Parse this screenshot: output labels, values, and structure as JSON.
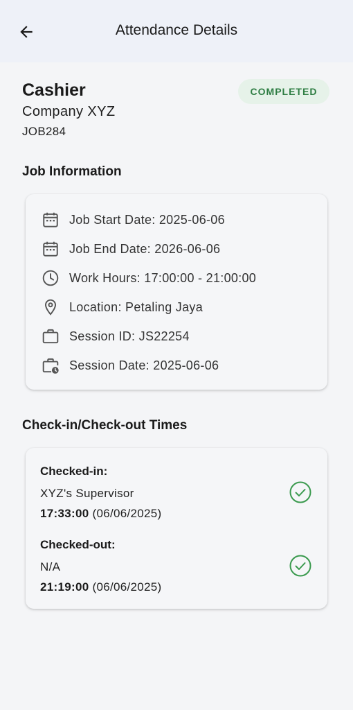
{
  "header": {
    "title": "Attendance Details",
    "back_icon": "arrow-left-icon"
  },
  "job": {
    "title": "Cashier",
    "company": "Company XYZ",
    "code": "JOB284",
    "status": "COMPLETED",
    "status_color": "#2e7d43",
    "status_bg": "#e6f2e9"
  },
  "job_info": {
    "section_title": "Job Information",
    "rows": [
      {
        "icon": "calendar-icon",
        "text": "Job Start Date: 2025-06-06"
      },
      {
        "icon": "calendar-icon",
        "text": "Job End Date: 2026-06-06"
      },
      {
        "icon": "clock-icon",
        "text": "Work Hours: 17:00:00 - 21:00:00"
      },
      {
        "icon": "location-pin-icon",
        "text": "Location: Petaling Jaya"
      },
      {
        "icon": "briefcase-icon",
        "text": "Session ID: JS22254"
      },
      {
        "icon": "briefcase-clock-icon",
        "text": "Session Date: 2025-06-06"
      }
    ]
  },
  "check_times": {
    "section_title": "Check-in/Check-out Times",
    "check_in": {
      "label": "Checked-in:",
      "by": "XYZ's Supervisor",
      "time": "17:33:00",
      "date": "(06/06/2025)",
      "icon": "check-circle-icon"
    },
    "check_out": {
      "label": "Checked-out:",
      "by": "N/A",
      "time": "21:19:00",
      "date": "(06/06/2025)",
      "icon": "check-circle-icon"
    }
  }
}
